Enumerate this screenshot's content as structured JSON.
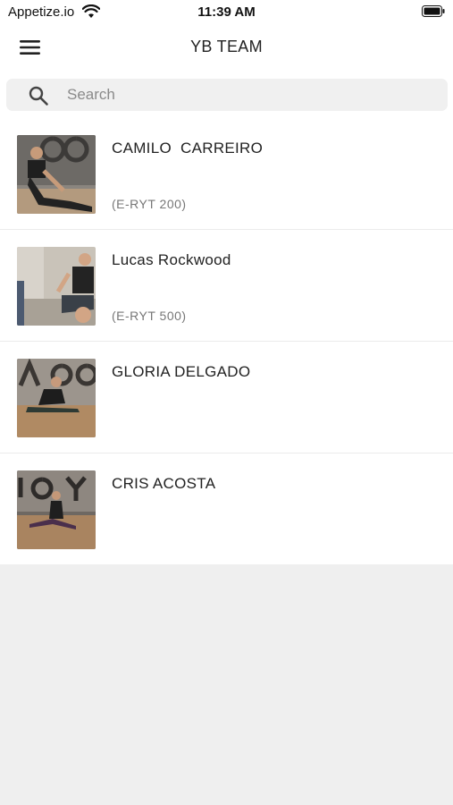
{
  "status_bar": {
    "carrier": "Appetize.io",
    "time": "11:39 AM"
  },
  "nav": {
    "title": "YB TEAM",
    "menu_icon": "hamburger-menu-icon"
  },
  "search": {
    "placeholder": "Search",
    "value": "",
    "icon": "search-icon"
  },
  "team": [
    {
      "name": "CAMILO  CARREIRO",
      "credential": "(E-RYT 200)"
    },
    {
      "name": "Lucas Rockwood",
      "credential": "(E-RYT 500)"
    },
    {
      "name": "GLORIA DELGADO",
      "credential": ""
    },
    {
      "name": "CRIS ACOSTA",
      "credential": ""
    }
  ],
  "colors": {
    "background": "#efefef",
    "surface": "#ffffff",
    "text": "#222222",
    "muted": "#777777"
  }
}
